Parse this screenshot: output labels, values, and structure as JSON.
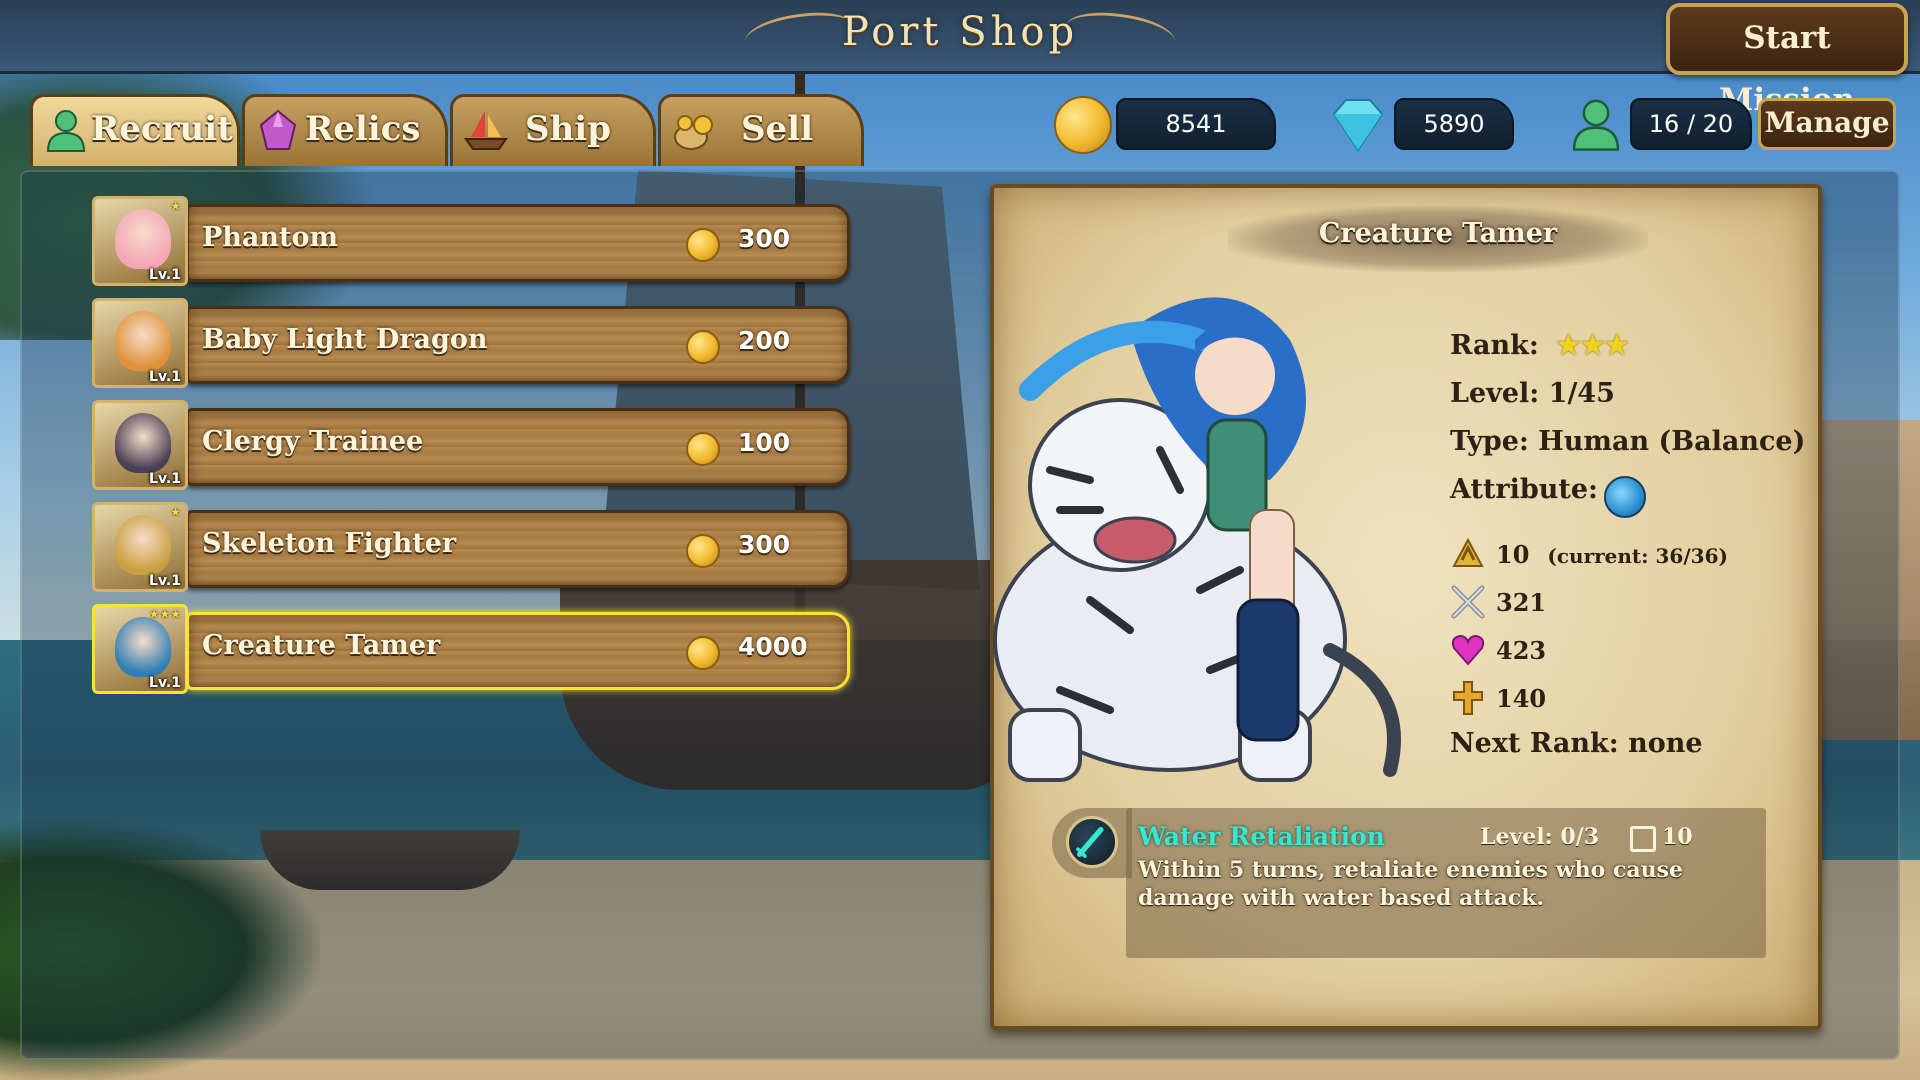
{
  "header": {
    "title": "Port Shop",
    "start_button": "Start Mission"
  },
  "tabs": [
    {
      "label": "Recruit",
      "icon": "recruit-person-icon",
      "active": true
    },
    {
      "label": "Relics",
      "icon": "crystal-icon",
      "active": false
    },
    {
      "label": "Ship",
      "icon": "ship-icon",
      "active": false
    },
    {
      "label": "Sell",
      "icon": "coin-sack-icon",
      "active": false
    }
  ],
  "resources": {
    "gold": "8541",
    "gems": "5890",
    "party": "16 / 20",
    "manage_label": "Manage"
  },
  "recruit_list": [
    {
      "name": "Phantom",
      "price": "300",
      "level": "Lv.1",
      "stars": "★",
      "selected": false,
      "color": "#f4a6b8"
    },
    {
      "name": "Baby Light Dragon",
      "price": "200",
      "level": "Lv.1",
      "stars": "",
      "selected": false,
      "color": "#e0913a"
    },
    {
      "name": "Clergy Trainee",
      "price": "100",
      "level": "Lv.1",
      "stars": "",
      "selected": false,
      "color": "#4a3f55"
    },
    {
      "name": "Skeleton Fighter",
      "price": "300",
      "level": "Lv.1",
      "stars": "★",
      "selected": false,
      "color": "#c9a040"
    },
    {
      "name": "Creature Tamer",
      "price": "4000",
      "level": "Lv.1",
      "stars": "★★★",
      "selected": true,
      "color": "#2f7fb3"
    }
  ],
  "detail": {
    "name": "Creature Tamer",
    "rank_label": "Rank:",
    "rank_stars": "★★★",
    "level": "Level: 1/45",
    "type": "Type: Human (Balance)",
    "attribute_label": "Attribute:",
    "attribute_icon": "water-orb-icon",
    "cost_value": "10",
    "cost_current": "(current: 36/36)",
    "attack": "321",
    "hp": "423",
    "defense": "140",
    "next_rank": "Next Rank: none"
  },
  "skill": {
    "name": "Water Retaliation",
    "level": "Level: 0/3",
    "cooldown": "10",
    "description": "Within 5 turns, retaliate enemies who cause damage with water based attack."
  },
  "colors": {
    "gold_text": "#f3e2b3",
    "skill_name": "#39e6d2",
    "selection": "#f6e332"
  }
}
